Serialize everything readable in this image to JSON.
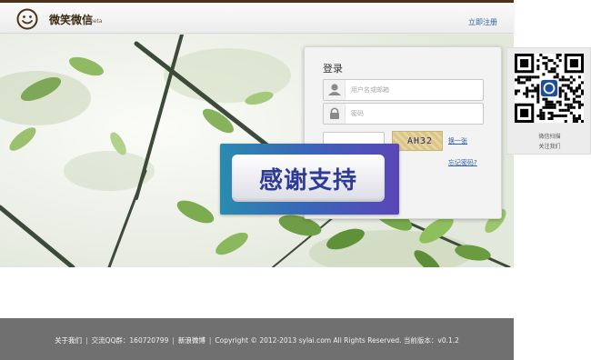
{
  "header": {
    "brand": "微笑微信",
    "beta": "beta",
    "register_link": "立即注册"
  },
  "login": {
    "title": "登录",
    "username_placeholder": "用户名或邮箱",
    "password_placeholder": "密码",
    "captcha_text": "AH32",
    "refresh_link": "换一张",
    "forgot_link": "忘记密码?"
  },
  "qr": {
    "caption_line1": "微信扫描",
    "caption_line2": "关注我们"
  },
  "banner": {
    "text": "感谢支持"
  },
  "footer": {
    "about": "关于我们",
    "qq_group": "交流QQ群：160720799",
    "weibo": "新浪微博",
    "copyright": "Copyright © 2012-2013 sylai.com All Rights Reserved. 当前版本：v0.1.2"
  },
  "colors": {
    "topbar": "#4b3518",
    "link": "#2d5fa8",
    "footer_bg": "#707070",
    "banner_text": "#2e3b96"
  },
  "icons": {
    "logo": "smiley-face-icon",
    "username": "user-icon",
    "password": "lock-icon"
  }
}
